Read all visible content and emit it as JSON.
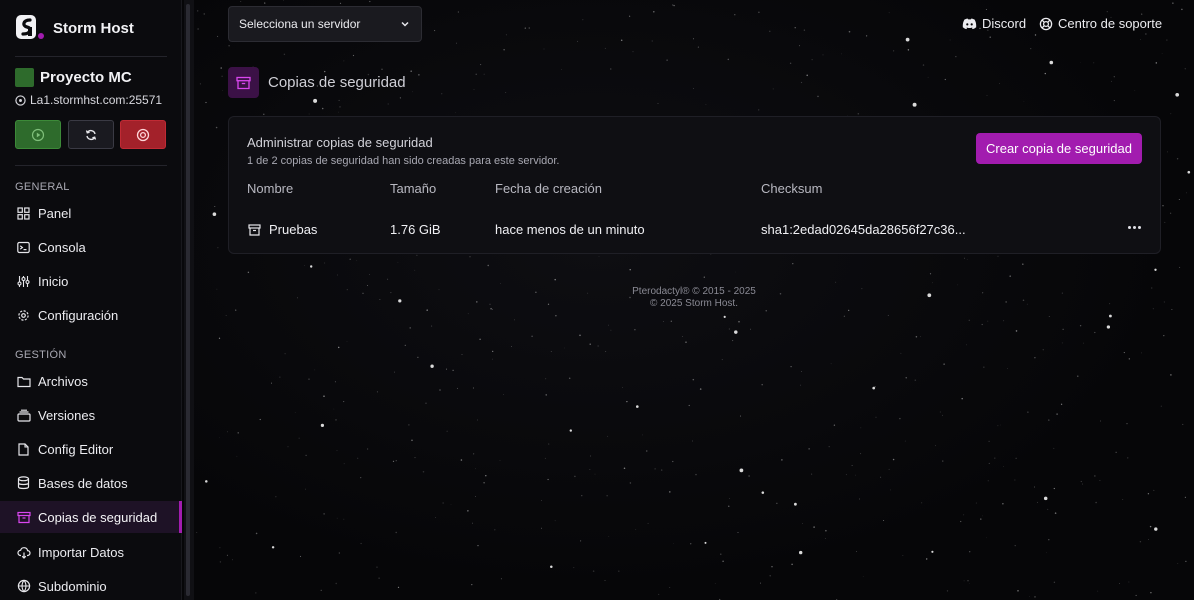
{
  "brand": {
    "name": "Storm Host"
  },
  "server": {
    "name": "Proyecto MC",
    "address": "La1.stormhst.com:25571",
    "color": "#2e6b2c"
  },
  "power": {
    "start_icon": "play-icon",
    "restart_icon": "refresh-icon",
    "stop_icon": "stop-icon"
  },
  "sidebar": {
    "sections": [
      {
        "label": "GENERAL"
      },
      {
        "label": "GESTIÓN"
      }
    ],
    "items": [
      {
        "label": "Panel",
        "icon": "grid-icon"
      },
      {
        "label": "Consola",
        "icon": "terminal-icon"
      },
      {
        "label": "Inicio",
        "icon": "sliders-icon"
      },
      {
        "label": "Configuración",
        "icon": "gear-icon"
      },
      {
        "label": "Archivos",
        "icon": "folder-icon"
      },
      {
        "label": "Versiones",
        "icon": "layers-icon"
      },
      {
        "label": "Config Editor",
        "icon": "file-edit-icon"
      },
      {
        "label": "Bases de datos",
        "icon": "database-icon"
      },
      {
        "label": "Copias de seguridad",
        "icon": "archive-icon",
        "active": true
      },
      {
        "label": "Importar Datos",
        "icon": "cloud-download-icon"
      },
      {
        "label": "Subdominio",
        "icon": "globe-icon"
      }
    ]
  },
  "header": {
    "server_select": "Selecciona un servidor",
    "discord": "Discord",
    "support": "Centro de soporte"
  },
  "page": {
    "title": "Copias de seguridad"
  },
  "backups": {
    "title": "Administrar copias de seguridad",
    "subtitle": "1 de 2 copias de seguridad han sido creadas para este servidor.",
    "create_label": "Crear copia de seguridad",
    "columns": [
      "Nombre",
      "Tamaño",
      "Fecha de creación",
      "Checksum"
    ],
    "rows": [
      {
        "name": "Pruebas",
        "size": "1.76 GiB",
        "date": "hace menos de un minuto",
        "checksum": "sha1:2edad02645da28656f27c36..."
      }
    ]
  },
  "footer": {
    "line1": "Pterodactyl® © 2015 - 2025",
    "line2": "© 2025 Storm Host."
  },
  "colors": {
    "accent": "#a21caf",
    "start": "#2e6b2c",
    "stop": "#a3212a"
  }
}
